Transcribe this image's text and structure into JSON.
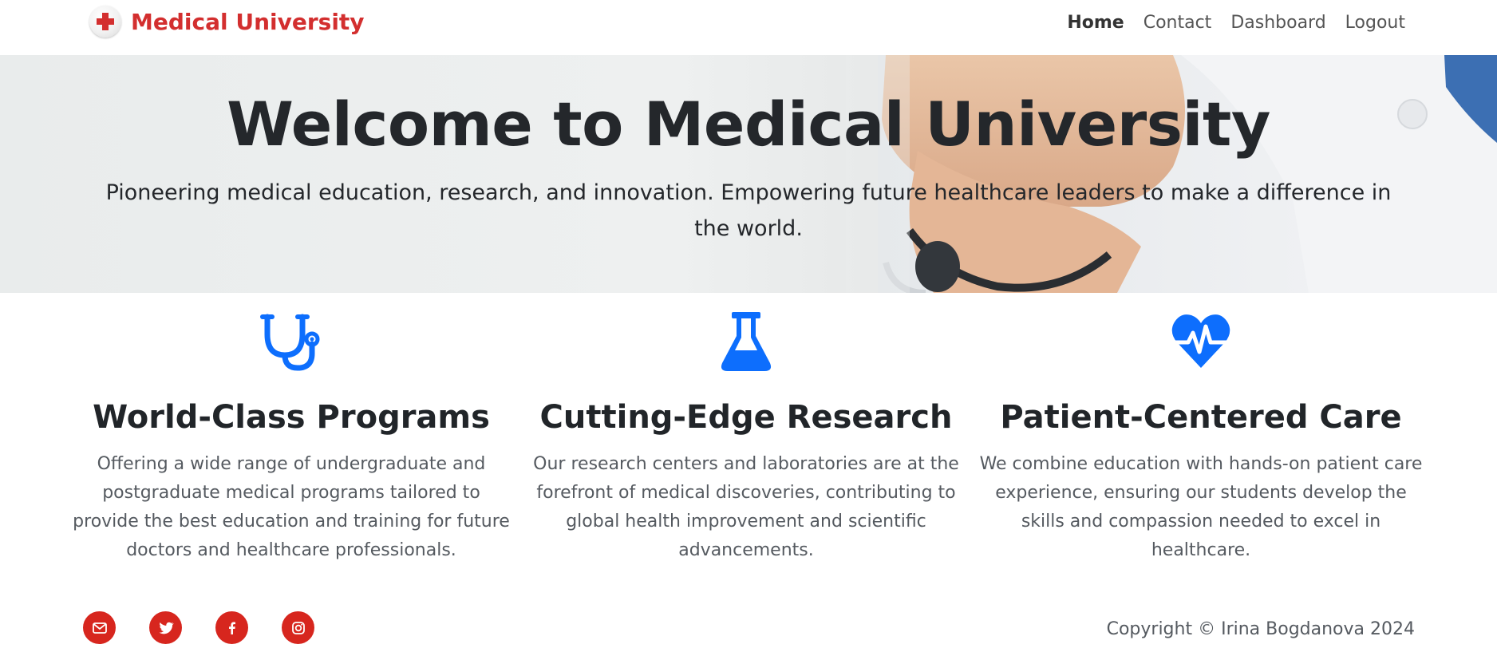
{
  "navbar": {
    "brand": {
      "name": "Medical University",
      "icon": "red-cross-icon"
    },
    "links": [
      {
        "label": "Home",
        "active": true
      },
      {
        "label": "Contact",
        "active": false
      },
      {
        "label": "Dashboard",
        "active": false
      },
      {
        "label": "Logout",
        "active": false
      }
    ]
  },
  "hero": {
    "title": "Welcome to Medical University",
    "subtitle": "Pioneering medical education, research, and innovation. Empowering future healthcare leaders to make a difference in the world."
  },
  "features": [
    {
      "icon": "stethoscope-icon",
      "title": "World-Class Programs",
      "text": "Offering a wide range of undergraduate and postgraduate medical programs tailored to provide the best education and training for future doctors and healthcare professionals."
    },
    {
      "icon": "flask-icon",
      "title": "Cutting-Edge Research",
      "text": "Our research centers and laboratories are at the forefront of medical discoveries, contributing to global health improvement and scientific advancements."
    },
    {
      "icon": "heart-pulse-icon",
      "title": "Patient-Centered Care",
      "text": "We combine education with hands-on patient care experience, ensuring our students develop the skills and compassion needed to excel in healthcare."
    }
  ],
  "footer": {
    "social": [
      "envelope-icon",
      "twitter-icon",
      "facebook-icon",
      "instagram-icon"
    ],
    "copyright": "Copyright © Irina Bogdanova 2024"
  },
  "colors": {
    "brand": "#d32f2f",
    "accent": "#0d6efd",
    "social": "#d7261e"
  }
}
